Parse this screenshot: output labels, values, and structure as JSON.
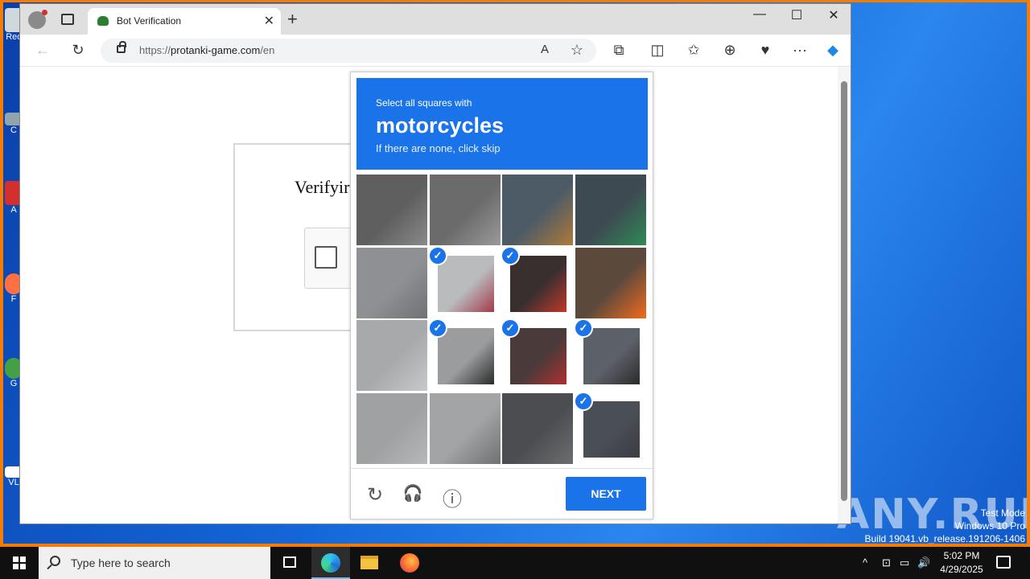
{
  "desktop": {
    "icons": [
      {
        "label": "Rec",
        "color": "#cfd8dc"
      },
      {
        "label": "C",
        "color": "#90a4ae"
      },
      {
        "label": "A",
        "color": "#d32f2f"
      },
      {
        "label": "F",
        "color": "#ff7043"
      },
      {
        "label": "G",
        "color": "#43a047"
      },
      {
        "label": "VL",
        "color": "#ffffff"
      }
    ],
    "watermark": "ANY.RUN",
    "test_mode": {
      "line1": "Test Mode",
      "line2": "Windows 10 Pro",
      "line3": "Build 19041.vb_release.191206-1406"
    }
  },
  "browser": {
    "tab_title": "Bot Verification",
    "tab_close": "✕",
    "new_tab": "+",
    "window_controls": {
      "minimize": "—",
      "maximize": "☐",
      "close": "✕"
    },
    "url_scheme": "https://",
    "url_host": "protanki-game.com",
    "url_path": "/en",
    "toolbar_icons": {
      "back": "←",
      "refresh": "↻",
      "read_aloud": "A",
      "favorite": "☆",
      "extensions": "⧉",
      "split": "◫",
      "favorites": "✩",
      "collections": "⊕",
      "health": "♥",
      "more": "···",
      "copilot": "◆"
    }
  },
  "page": {
    "verify_title": "Verifyir"
  },
  "captcha": {
    "instruction_small": "Select all squares with",
    "target": "motorcycles",
    "hint": "If there are none, click skip",
    "tiles": [
      {
        "selected": false,
        "bg": "#5f5f5f",
        "fg": "#8a8a8a"
      },
      {
        "selected": false,
        "bg": "#6b6b6b",
        "fg": "#9a9a9a"
      },
      {
        "selected": false,
        "bg": "#4d5b66",
        "fg": "#b07a3a"
      },
      {
        "selected": false,
        "bg": "#3e4a52",
        "fg": "#2e8b57"
      },
      {
        "selected": false,
        "bg": "#8e9094",
        "fg": "#6f7175"
      },
      {
        "selected": true,
        "bg": "#b9bbbd",
        "fg": "#a33a4a"
      },
      {
        "selected": true,
        "bg": "#3a2f2f",
        "fg": "#c0392b"
      },
      {
        "selected": false,
        "bg": "#5b4a3c",
        "fg": "#f26b1d"
      },
      {
        "selected": false,
        "bg": "#a7a9ab",
        "fg": "#c8c9cb"
      },
      {
        "selected": true,
        "bg": "#9a9c9e",
        "fg": "#2a2a2a"
      },
      {
        "selected": true,
        "bg": "#4a3a3a",
        "fg": "#b03030"
      },
      {
        "selected": true,
        "bg": "#5c6068",
        "fg": "#2b2b2b"
      },
      {
        "selected": false,
        "bg": "#9fa1a3",
        "fg": "#b5b7b9"
      },
      {
        "selected": false,
        "bg": "#a2a4a6",
        "fg": "#6e7072"
      },
      {
        "selected": false,
        "bg": "#4b4d50",
        "fg": "#6c6e70"
      },
      {
        "selected": true,
        "bg": "#4a4e55",
        "fg": "#3a3d42"
      }
    ],
    "footer_icons": {
      "reload": "↻",
      "audio": "🎧",
      "info": "ⓘ"
    },
    "next_label": "NEXT"
  },
  "taskbar": {
    "search_placeholder": "Type here to search",
    "tray_icons": {
      "chevron": "^",
      "network": "▭",
      "volume": "🔊"
    },
    "time": "5:02 PM",
    "date": "4/29/2025"
  },
  "colors": {
    "accent": "#1a73e8",
    "frame": "#f57c00"
  }
}
